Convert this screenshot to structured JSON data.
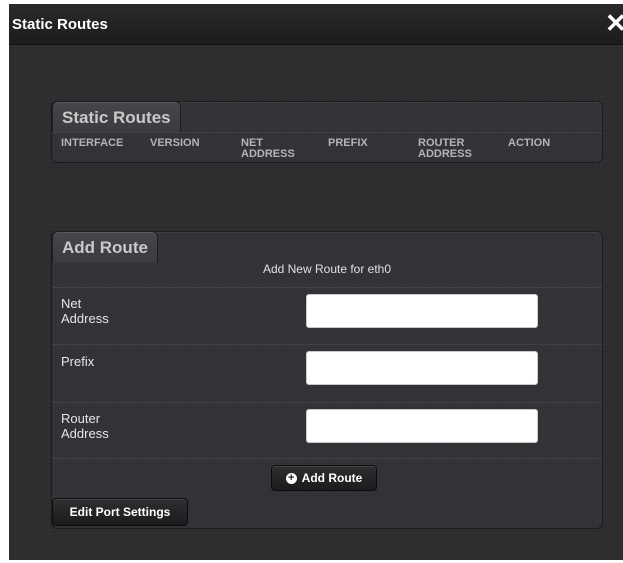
{
  "window": {
    "title": "Static Routes",
    "close_icon": "close-icon"
  },
  "routes_panel": {
    "title": "Static Routes",
    "columns": [
      "INTERFACE",
      "VERSION",
      "NET\nADDRESS",
      "PREFIX",
      "ROUTER\nADDRESS",
      "ACTION"
    ]
  },
  "add_panel": {
    "title": "Add Route",
    "subtitle": "Add New Route for eth0",
    "fields": [
      {
        "label": "Net\nAddress",
        "value": ""
      },
      {
        "label": "Prefix",
        "value": ""
      },
      {
        "label": "Router\nAddress",
        "value": ""
      }
    ],
    "add_button": "Add Route",
    "add_icon": "plus-circle-icon",
    "edit_port_button": "Edit Port Settings"
  }
}
